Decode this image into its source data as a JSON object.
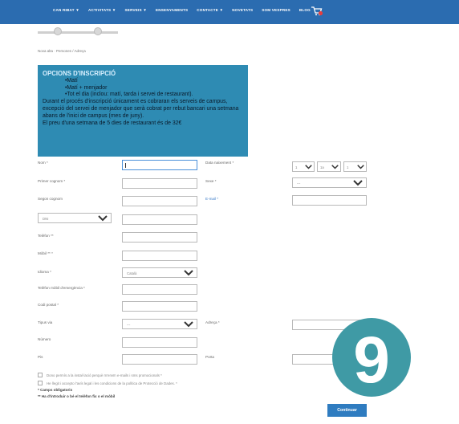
{
  "nav": {
    "items": [
      {
        "label": "CAN RIBAT ▼"
      },
      {
        "label": "ACTIVITATS ▼"
      },
      {
        "label": "SERVEIS ▼"
      },
      {
        "label": "ENSENYAMENTS"
      },
      {
        "label": "CONTACTE ▼"
      },
      {
        "label": "NOVETATS"
      },
      {
        "label": "SOM VESPRES"
      },
      {
        "label": "BLOG"
      }
    ],
    "cart_icon": "shopping-cart-icon",
    "cart_badge_color": "#e53e3e",
    "background": "#2b6cb0"
  },
  "breadcrumb": "Nova alta · Persones / Adreça",
  "info": {
    "title": "OPCIONS D'INSCRIPCIÓ",
    "options": [
      "•Matí",
      "•Matí + menjador",
      "•Tot el dia (inclou: matí, tarda i servei de restaurant)."
    ],
    "paragraph1": "Durant el procés d'inscripció únicament es cobraran els serveis de campus, excepció del servei de menjador que serà cobrat per rebut bancari una setmana abans de l'inici de campus (mes de juny).",
    "paragraph2": "El preu d'una setmana de 5 dies de restaurant és de 32€",
    "background": "#2e8bb3"
  },
  "form": {
    "nom_label": "Nom *",
    "primer_cognom_label": "Primer cognom *",
    "segon_cognom_label": "Segon cognom",
    "data_naixement_label": "Data naixement *",
    "sexe_label": "Sexe *",
    "email_label": "E-mail *",
    "doc_type_value": "DNI",
    "telefon_label": "Telèfon **",
    "mobil_label": "Mòbil ** *",
    "idioma_label": "Idioma *",
    "idioma_value": "Català",
    "telefon_emergencia_label": "Telèfon mòbil d'emergència *",
    "codi_postal_label": "Codi postal *",
    "tipus_via_label": "Tipus via",
    "tipus_via_value": "---",
    "adreca_label": "Adreça *",
    "numero_label": "Número",
    "pis_label": "Pis",
    "porta_label": "Porta",
    "sexe_value": "---",
    "day_value": "1",
    "month_value": "1a",
    "year_value": "1"
  },
  "consent": {
    "check1": "Dono permís a la instal·lació perquè m'envïn e-mails i sms promocionals *",
    "check2": "He llegit i accepto l'avís legal i les condicions de la política de Protecció de Dades. *"
  },
  "footnotes": {
    "required": "* Camps obligatoris",
    "phone": "** Ha d'introduir o bé el telèfon fix o el mòbil"
  },
  "submit_label": "Continuar",
  "badge": {
    "number": "9",
    "color": "#3f9aa5"
  }
}
